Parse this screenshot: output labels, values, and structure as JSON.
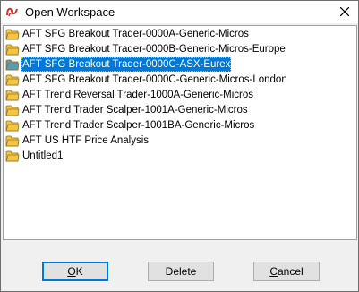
{
  "window": {
    "title": "Open Workspace",
    "app_icon": "ninjatrader-logo-icon",
    "close_icon": "close-icon"
  },
  "list": {
    "items": [
      {
        "label": "AFT SFG Breakout Trader-0000A-Generic-Micros",
        "icon": "folder-icon",
        "selected": false
      },
      {
        "label": "AFT SFG Breakout Trader-0000B-Generic-Micros-Europe",
        "icon": "folder-icon",
        "selected": false
      },
      {
        "label": "AFT SFG Breakout Trader-0000C-ASX-Eurex",
        "icon": "folder-icon",
        "selected": true
      },
      {
        "label": "AFT SFG Breakout Trader-0000C-Generic-Micros-London",
        "icon": "folder-icon",
        "selected": false
      },
      {
        "label": "AFT Trend Reversal Trader-1000A-Generic-Micros",
        "icon": "folder-icon",
        "selected": false
      },
      {
        "label": "AFT Trend Trader Scalper-1001A-Generic-Micros",
        "icon": "folder-icon",
        "selected": false
      },
      {
        "label": "AFT Trend Trader Scalper-1001BA-Generic-Micros",
        "icon": "folder-icon",
        "selected": false
      },
      {
        "label": "AFT US HTF Price Analysis",
        "icon": "folder-icon",
        "selected": false
      },
      {
        "label": "Untitled1",
        "icon": "folder-icon",
        "selected": false
      }
    ]
  },
  "buttons": {
    "ok": {
      "mnemonic": "O",
      "rest": "K"
    },
    "delete": {
      "label": "Delete"
    },
    "cancel": {
      "mnemonic": "C",
      "rest": "ancel"
    }
  },
  "colors": {
    "selection": "#0078d7",
    "folder_yellow": "#f5c542",
    "folder_selected": "#5a9bb8"
  }
}
